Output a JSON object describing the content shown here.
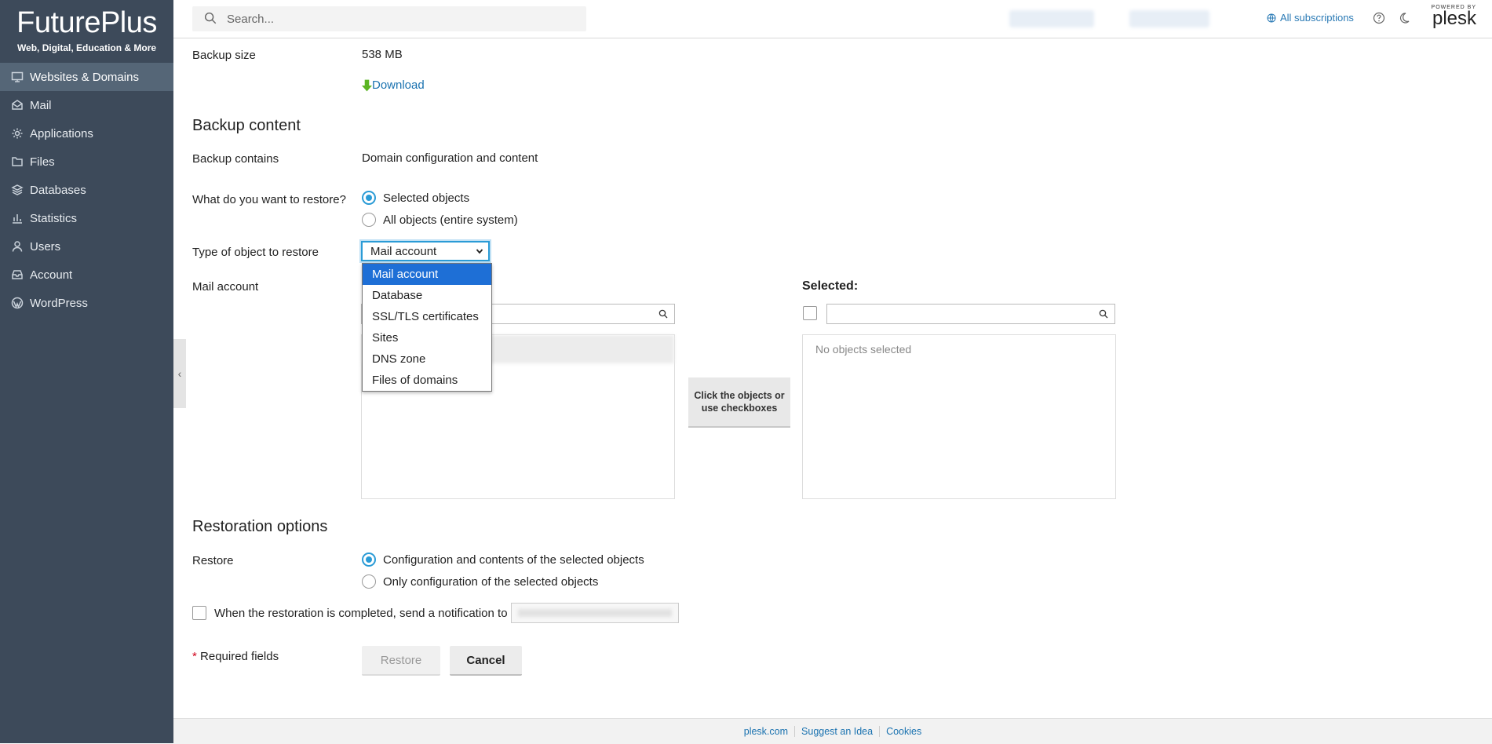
{
  "brand": {
    "name": "FuturePlus",
    "tagline": "Web, Digital, Education & More"
  },
  "sidebar": {
    "items": [
      {
        "label": "Websites & Domains",
        "icon": "monitor-icon",
        "active": true
      },
      {
        "label": "Mail",
        "icon": "envelope-icon"
      },
      {
        "label": "Applications",
        "icon": "gear-icon"
      },
      {
        "label": "Files",
        "icon": "folder-icon"
      },
      {
        "label": "Databases",
        "icon": "layers-icon"
      },
      {
        "label": "Statistics",
        "icon": "bar-chart-icon"
      },
      {
        "label": "Users",
        "icon": "user-icon"
      },
      {
        "label": "Account",
        "icon": "inbox-icon"
      },
      {
        "label": "WordPress",
        "icon": "wordpress-icon"
      }
    ]
  },
  "header": {
    "search_placeholder": "Search...",
    "subscriptions_link": "All subscriptions",
    "plesk_powered": "POWERED BY",
    "plesk_name": "plesk"
  },
  "backup": {
    "size_label": "Backup size",
    "size_value": "538 MB",
    "download_label": "Download",
    "content_title": "Backup content",
    "contains_label": "Backup contains",
    "contains_value": "Domain configuration and content",
    "restore_what_label": "What do you want to restore?",
    "restore_options": [
      "Selected objects",
      "All objects (entire system)"
    ],
    "restore_selected": "Selected objects",
    "type_label": "Type of object to restore",
    "type_value": "Mail account",
    "type_options": [
      "Mail account",
      "Database",
      "SSL/TLS certificates",
      "Sites",
      "DNS zone",
      "Files of domains"
    ],
    "object_label": "Mail account",
    "selected_heading": "Selected:",
    "no_objects_text": "No objects selected",
    "move_button": "Click the objects or use checkboxes"
  },
  "restoration": {
    "title": "Restoration options",
    "restore_label": "Restore",
    "options": [
      "Configuration and contents of the selected objects",
      "Only configuration of the selected objects"
    ],
    "selected": "Configuration and contents of the selected objects",
    "notify_label": "When the restoration is completed, send a notification to",
    "required_star": "*",
    "required_label": "Required fields",
    "restore_button": "Restore",
    "cancel_button": "Cancel"
  },
  "footer": {
    "links": [
      "plesk.com",
      "Suggest an Idea",
      "Cookies"
    ]
  },
  "colors": {
    "sidebar_bg": "#3d4a5a",
    "accent_blue": "#2a9bd6",
    "link_blue": "#1a72b0",
    "dropdown_highlight": "#1e6fd6",
    "download_green": "#5bb522"
  }
}
